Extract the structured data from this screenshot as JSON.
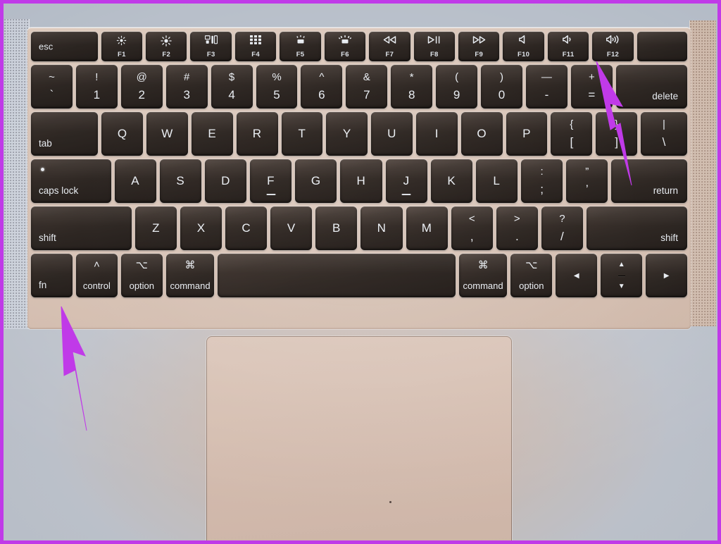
{
  "scene": {
    "subject": "MacBook keyboard and trackpad photo",
    "frame_color": "#c03ae8",
    "annotation_color": "#c03ae8",
    "deck_color": "#dcc9bd",
    "key_color": "#2e2723",
    "key_text_color": "#e9edf2",
    "trackpad_color": "#d9c4b8"
  },
  "annotations": [
    {
      "name": "arrow-to-f11-key",
      "points_to": "F11",
      "color": "#c03ae8"
    },
    {
      "name": "arrow-to-fn-key",
      "points_to": "fn",
      "color": "#c03ae8"
    }
  ],
  "keyboard": {
    "function_row": [
      {
        "label": "esc",
        "glyph": "",
        "fkey": "",
        "icon": "escape-key"
      },
      {
        "label": "",
        "glyph": "☀",
        "fkey": "F1",
        "icon": "brightness-down-icon"
      },
      {
        "label": "",
        "glyph": "☀",
        "fkey": "F2",
        "icon": "brightness-up-icon"
      },
      {
        "label": "",
        "glyph": "",
        "fkey": "F3",
        "icon": "mission-control-icon"
      },
      {
        "label": "",
        "glyph": "",
        "fkey": "F4",
        "icon": "launchpad-icon"
      },
      {
        "label": "",
        "glyph": "",
        "fkey": "F5",
        "icon": "keyboard-brightness-down-icon"
      },
      {
        "label": "",
        "glyph": "",
        "fkey": "F6",
        "icon": "keyboard-brightness-up-icon"
      },
      {
        "label": "",
        "glyph": "◁◁",
        "fkey": "F7",
        "icon": "rewind-icon"
      },
      {
        "label": "",
        "glyph": "▷‖",
        "fkey": "F8",
        "icon": "play-pause-icon"
      },
      {
        "label": "",
        "glyph": "▷▷",
        "fkey": "F9",
        "icon": "fast-forward-icon"
      },
      {
        "label": "",
        "glyph": "◁",
        "fkey": "F10",
        "icon": "mute-icon"
      },
      {
        "label": "",
        "glyph": "◁)",
        "fkey": "F11",
        "icon": "volume-down-icon"
      },
      {
        "label": "",
        "glyph": "◁))",
        "fkey": "F12",
        "icon": "volume-up-icon"
      },
      {
        "label": "",
        "glyph": "",
        "fkey": "",
        "icon": "touch-id-key"
      }
    ],
    "number_row": [
      {
        "up": "~",
        "down": "`",
        "name": "tilde-backtick-key"
      },
      {
        "up": "!",
        "down": "1",
        "name": "one-key"
      },
      {
        "up": "@",
        "down": "2",
        "name": "two-key"
      },
      {
        "up": "#",
        "down": "3",
        "name": "three-key"
      },
      {
        "up": "$",
        "down": "4",
        "name": "four-key"
      },
      {
        "up": "%",
        "down": "5",
        "name": "five-key"
      },
      {
        "up": "^",
        "down": "6",
        "name": "six-key"
      },
      {
        "up": "&",
        "down": "7",
        "name": "seven-key"
      },
      {
        "up": "*",
        "down": "8",
        "name": "eight-key"
      },
      {
        "up": "(",
        "down": "9",
        "name": "nine-key"
      },
      {
        "up": ")",
        "down": "0",
        "name": "zero-key"
      },
      {
        "up": "—",
        "down": "-",
        "name": "minus-key"
      },
      {
        "up": "+",
        "down": "=",
        "name": "equals-key"
      },
      {
        "up": "",
        "down": "delete",
        "name": "delete-key"
      }
    ],
    "qwerty_row": [
      {
        "label": "tab",
        "name": "tab-key"
      },
      {
        "label": "Q",
        "name": "q-key"
      },
      {
        "label": "W",
        "name": "w-key"
      },
      {
        "label": "E",
        "name": "e-key"
      },
      {
        "label": "R",
        "name": "r-key"
      },
      {
        "label": "T",
        "name": "t-key"
      },
      {
        "label": "Y",
        "name": "y-key"
      },
      {
        "label": "U",
        "name": "u-key"
      },
      {
        "label": "I",
        "name": "i-key"
      },
      {
        "label": "O",
        "name": "o-key"
      },
      {
        "label": "P",
        "name": "p-key"
      },
      {
        "up": "{",
        "down": "[",
        "name": "left-bracket-key"
      },
      {
        "up": "}",
        "down": "]",
        "name": "right-bracket-key"
      },
      {
        "up": "|",
        "down": "\\",
        "name": "backslash-key"
      }
    ],
    "home_row": [
      {
        "label": "caps lock",
        "name": "caps-lock-key"
      },
      {
        "label": "A",
        "name": "a-key"
      },
      {
        "label": "S",
        "name": "s-key"
      },
      {
        "label": "D",
        "name": "d-key"
      },
      {
        "label": "F",
        "name": "f-key"
      },
      {
        "label": "G",
        "name": "g-key"
      },
      {
        "label": "H",
        "name": "h-key"
      },
      {
        "label": "J",
        "name": "j-key"
      },
      {
        "label": "K",
        "name": "k-key"
      },
      {
        "label": "L",
        "name": "l-key"
      },
      {
        "up": ":",
        "down": ";",
        "name": "semicolon-key"
      },
      {
        "up": "”",
        "down": "’",
        "name": "quote-key"
      },
      {
        "label": "return",
        "name": "return-key"
      }
    ],
    "zxcv_row": [
      {
        "label": "shift",
        "name": "left-shift-key"
      },
      {
        "label": "Z",
        "name": "z-key"
      },
      {
        "label": "X",
        "name": "x-key"
      },
      {
        "label": "C",
        "name": "c-key"
      },
      {
        "label": "V",
        "name": "v-key"
      },
      {
        "label": "B",
        "name": "b-key"
      },
      {
        "label": "N",
        "name": "n-key"
      },
      {
        "label": "M",
        "name": "m-key"
      },
      {
        "up": "<",
        "down": ",",
        "name": "comma-key"
      },
      {
        "up": ">",
        "down": ".",
        "name": "period-key"
      },
      {
        "up": "?",
        "down": "/",
        "name": "slash-key"
      },
      {
        "label": "shift",
        "name": "right-shift-key"
      }
    ],
    "bottom_row": [
      {
        "sym": "",
        "word": "fn",
        "name": "fn-key"
      },
      {
        "sym": "˄",
        "word": "control",
        "name": "control-key"
      },
      {
        "sym": "⌥",
        "word": "option",
        "name": "left-option-key"
      },
      {
        "sym": "⌘",
        "word": "command",
        "name": "left-command-key"
      },
      {
        "sym": "",
        "word": "",
        "name": "space-key"
      },
      {
        "sym": "⌘",
        "word": "command",
        "name": "right-command-key"
      },
      {
        "sym": "⌥",
        "word": "option",
        "name": "right-option-key"
      },
      {
        "sym": "◀",
        "word": "",
        "name": "left-arrow-key"
      },
      {
        "sym": "▲▼",
        "word": "",
        "name": "up-down-arrow-key"
      },
      {
        "sym": "▶",
        "word": "",
        "name": "right-arrow-key"
      }
    ]
  }
}
